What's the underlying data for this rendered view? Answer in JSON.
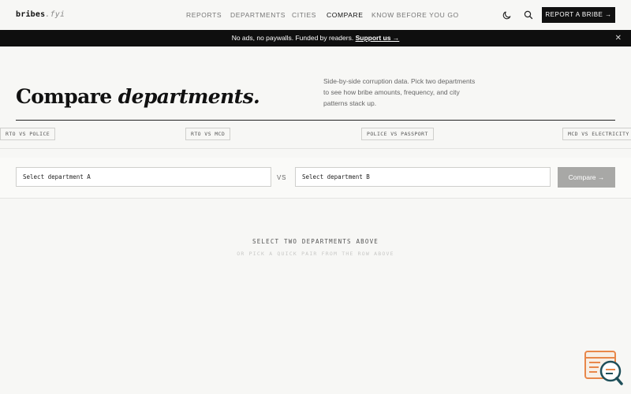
{
  "header": {
    "logo_main": "bribes",
    "logo_tld": ".fyi",
    "nav": [
      {
        "label": "REPORTS",
        "active": false
      },
      {
        "label": "DEPARTMENTS",
        "active": false
      },
      {
        "label": "CITIES",
        "active": false
      },
      {
        "label": "COMPARE",
        "active": true
      },
      {
        "label": "KNOW BEFORE YOU GO",
        "active": false
      }
    ],
    "theme_icon": "moon-icon",
    "search_icon": "search-icon",
    "report_button": "REPORT A BRIBE →"
  },
  "banner": {
    "text": "No ads, no paywalls. Funded by readers.",
    "link": "Support us →",
    "close": "✕"
  },
  "hero": {
    "title_plain": "Compare",
    "title_italic": "departments.",
    "description": "Side-by-side corruption data. Pick two departments to see how bribe amounts, frequency, and city patterns stack up."
  },
  "quick_pairs": [
    "RTO VS POLICE",
    "RTO VS MCD",
    "POLICE VS PASSPORT",
    "MCD VS ELECTRICITY"
  ],
  "compare": {
    "select_a": "Select department A",
    "vs": "VS",
    "select_b": "Select department B",
    "button": "Compare →"
  },
  "empty_state": {
    "title": "SELECT TWO DEPARTMENTS ABOVE",
    "subtitle": "OR PICK A QUICK PAIR FROM THE ROW ABOVE"
  },
  "colors": {
    "background": "#f7f7f5",
    "ink": "#111111",
    "banner": "#0f0f0f",
    "button_disabled": "#a8a8a6",
    "widget_orange": "#e8874a",
    "widget_teal": "#1f4f5a"
  }
}
